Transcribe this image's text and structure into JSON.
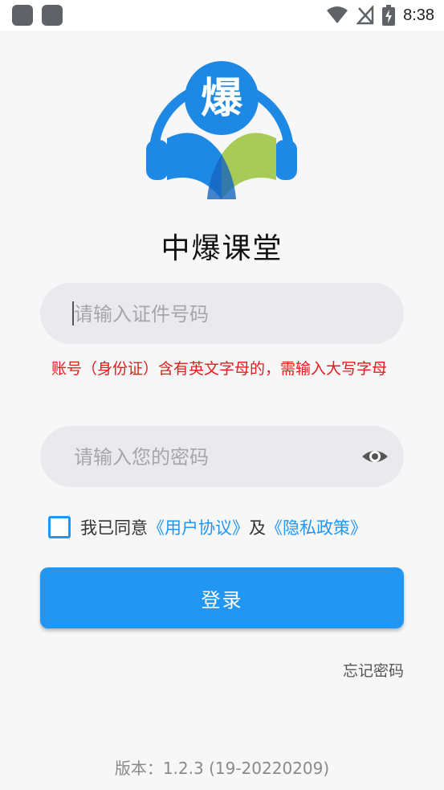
{
  "status_bar": {
    "time": "8:38"
  },
  "app": {
    "title": "中爆课堂",
    "logo_char": "爆"
  },
  "id_field": {
    "placeholder": "请输入证件号码",
    "value": ""
  },
  "warning": {
    "text": "账号（身份证）含有英文字母的，需输入大写字母"
  },
  "password_field": {
    "placeholder": "请输入您的密码",
    "value": ""
  },
  "agreement": {
    "prefix": "我已同意",
    "user_agreement": "《用户协议》",
    "conjunction": "及",
    "privacy_policy": "《隐私政策》",
    "checked": false
  },
  "login": {
    "label": "登录"
  },
  "forgot_password": {
    "label": "忘记密码"
  },
  "version": {
    "text": "版本：1.2.3 (19-20220209)"
  },
  "colors": {
    "accent": "#2196f3",
    "warning": "#e31b1b",
    "logo_green": "#a8cb58"
  }
}
